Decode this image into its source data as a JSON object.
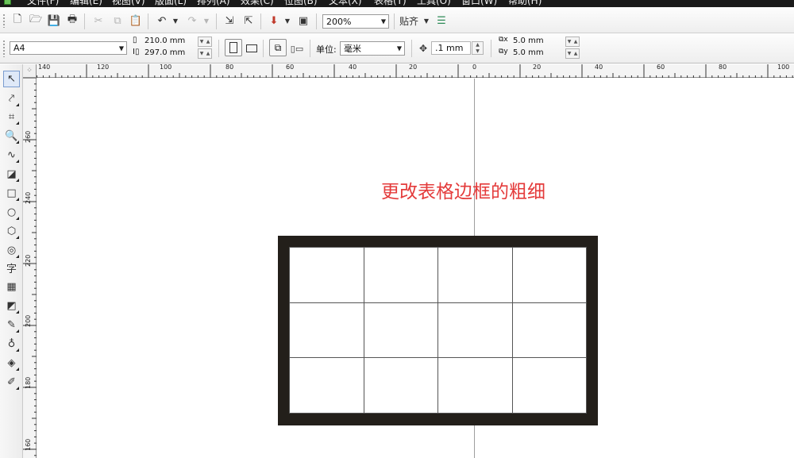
{
  "menu": {
    "items": [
      "文件(F)",
      "编辑(E)",
      "视图(V)",
      "版面(L)",
      "排列(A)",
      "效果(C)",
      "位图(B)",
      "文本(X)",
      "表格(T)",
      "工具(O)",
      "窗口(W)",
      "帮助(H)"
    ]
  },
  "toolbar": {
    "zoom_value": "200%",
    "snap_label": "贴齐"
  },
  "properties": {
    "page_size": "A4",
    "width": "210.0 mm",
    "height": "297.0 mm",
    "units_label": "单位:",
    "units_value": "毫米",
    "nudge": ".1 mm",
    "dup_x": "5.0 mm",
    "dup_y": "5.0 mm"
  },
  "toolbox": {
    "text_tool_glyph": "字"
  },
  "rulers": {
    "horizontal": [
      "140",
      "120",
      "100",
      "80",
      "60",
      "40",
      "20",
      "0",
      "20",
      "40",
      "60",
      "80",
      "100"
    ],
    "vertical": [
      "260",
      "240",
      "220",
      "200",
      "180",
      "160"
    ]
  },
  "canvas": {
    "annotation": "更改表格边框的粗细",
    "table": {
      "rows": 3,
      "cols": 4,
      "border_color": "#231f1a"
    }
  },
  "colors": {
    "annotation": "#e43b3b",
    "menubar": "#1a1a1a"
  }
}
